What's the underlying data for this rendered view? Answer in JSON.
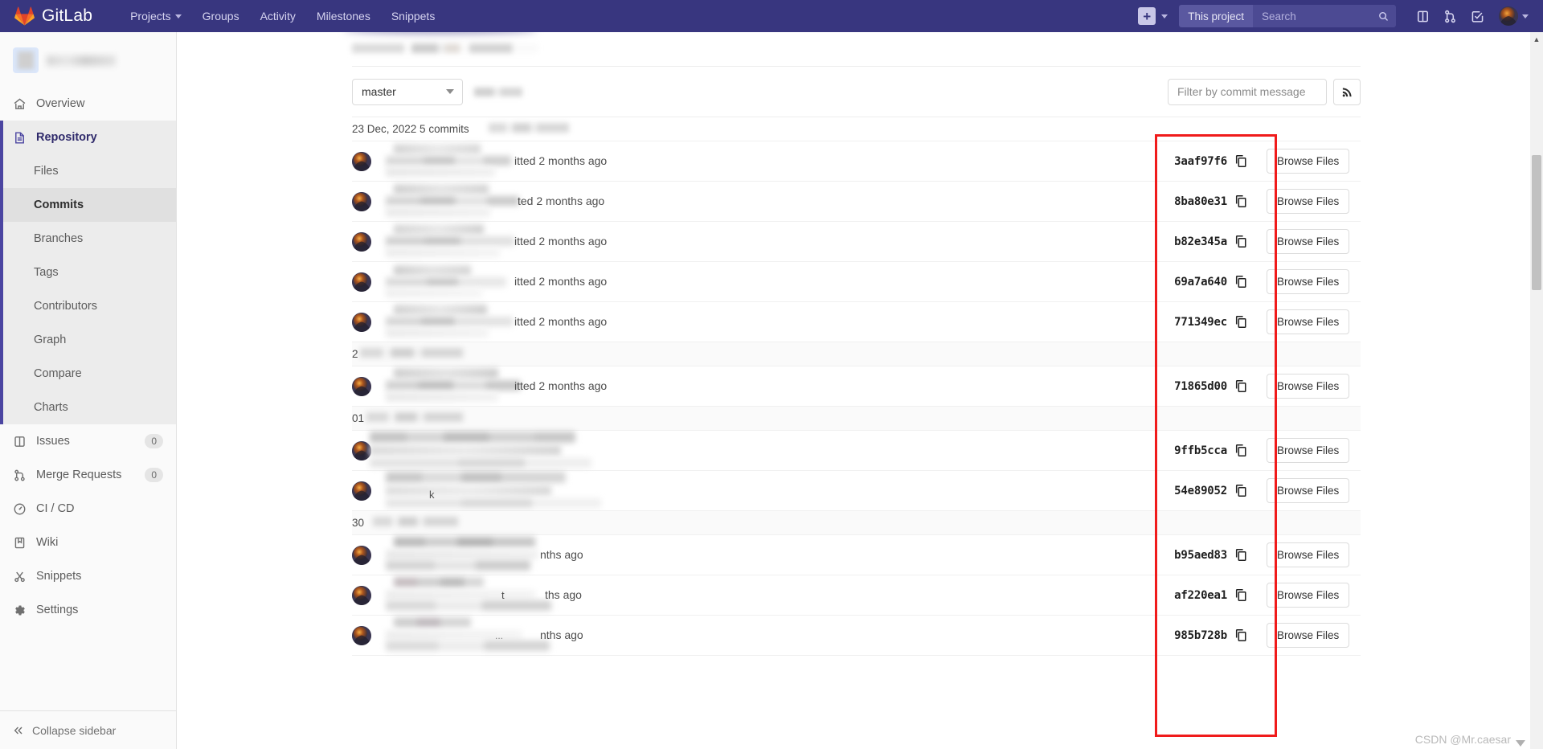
{
  "topnav": {
    "brand": "GitLab",
    "links": [
      {
        "label": "Projects",
        "has_caret": true
      },
      {
        "label": "Groups",
        "has_caret": false
      },
      {
        "label": "Activity",
        "has_caret": false
      },
      {
        "label": "Milestones",
        "has_caret": false
      },
      {
        "label": "Snippets",
        "has_caret": false
      }
    ],
    "plus_label": "+",
    "scope_label": "This project",
    "search_placeholder": "Search",
    "icons": [
      "plus-icon",
      "chevron-down-icon",
      "search-icon",
      "issues-icon",
      "merge-request-icon",
      "todos-icon",
      "avatar",
      "chevron-down-icon"
    ]
  },
  "sidebar": {
    "project_name": "",
    "items": [
      {
        "label": "Overview",
        "icon": "home-icon",
        "badge": null
      },
      {
        "label": "Repository",
        "icon": "document-icon",
        "badge": null,
        "active_section": true
      },
      {
        "label": "Issues",
        "icon": "issues-icon",
        "badge": "0"
      },
      {
        "label": "Merge Requests",
        "icon": "merge-request-icon",
        "badge": "0"
      },
      {
        "label": "CI / CD",
        "icon": "rocket-icon",
        "badge": null
      },
      {
        "label": "Wiki",
        "icon": "book-icon",
        "badge": null
      },
      {
        "label": "Snippets",
        "icon": "scissors-icon",
        "badge": null
      },
      {
        "label": "Settings",
        "icon": "gear-icon",
        "badge": null
      }
    ],
    "repository_sub_items": [
      {
        "label": "Files",
        "active": false
      },
      {
        "label": "Commits",
        "active": true
      },
      {
        "label": "Branches",
        "active": false
      },
      {
        "label": "Tags",
        "active": false
      },
      {
        "label": "Contributors",
        "active": false
      },
      {
        "label": "Graph",
        "active": false
      },
      {
        "label": "Compare",
        "active": false
      },
      {
        "label": "Charts",
        "active": false
      }
    ],
    "collapse_label": "Collapse sidebar"
  },
  "toolbar": {
    "branch": "master",
    "filter_placeholder": "Filter by commit message",
    "filter_value": "",
    "rss_icon": "rss-icon"
  },
  "commits": {
    "groups": [
      {
        "date_label": "23 Dec, 2022 5 commits",
        "date_blurred": false,
        "rows": [
          {
            "sha": "3aaf97f6",
            "time": "committed 2 months ago",
            "time_visible": "itted 2 months ago",
            "browse": "Browse Files"
          },
          {
            "sha": "8ba80e31",
            "time": "committed 2 months ago",
            "time_visible": "ted 2 months ago",
            "browse": "Browse Files"
          },
          {
            "sha": "b82e345a",
            "time": "committed 2 months ago",
            "time_visible": "itted 2 months ago",
            "browse": "Browse Files"
          },
          {
            "sha": "69a7a640",
            "time": "committed 2 months ago",
            "time_visible": "itted 2 months ago",
            "browse": "Browse Files"
          },
          {
            "sha": "771349ec",
            "time": "committed 2 months ago",
            "time_visible": "itted 2 months ago",
            "browse": "Browse Files"
          }
        ]
      },
      {
        "date_label": "2",
        "date_blurred": true,
        "rows": [
          {
            "sha": "71865d00",
            "time": "committed 2 months ago",
            "time_visible": "itted 2 months ago",
            "browse": "Browse Files"
          }
        ]
      },
      {
        "date_label": "01",
        "date_blurred": true,
        "rows": [
          {
            "sha": "9ffb5cca",
            "time": "",
            "time_visible": "",
            "browse": "Browse Files"
          },
          {
            "sha": "54e89052",
            "time": "",
            "time_visible": "",
            "browse": "Browse Files"
          }
        ]
      },
      {
        "date_label": "30",
        "date_blurred": true,
        "rows": [
          {
            "sha": "b95aed83",
            "time": "months ago",
            "time_visible": "nths ago",
            "browse": "Browse Files"
          },
          {
            "sha": "af220ea1",
            "time": "months ago",
            "time_visible": "ths ago",
            "browse": "Browse Files"
          },
          {
            "sha": "985b728b",
            "time": "months ago",
            "time_visible": "nths ago",
            "browse": "Browse Files"
          }
        ]
      }
    ]
  },
  "annotation": {
    "highlight_color": "#f01b1b",
    "highlight_target": "commit-sha-column"
  },
  "watermark": {
    "text": "CSDN @Mr.caesar"
  },
  "colors": {
    "navbar": "#38367f",
    "sidebar_bg": "#fafafa",
    "active_accent": "#4b45a1",
    "highlight": "#f01b1b"
  }
}
